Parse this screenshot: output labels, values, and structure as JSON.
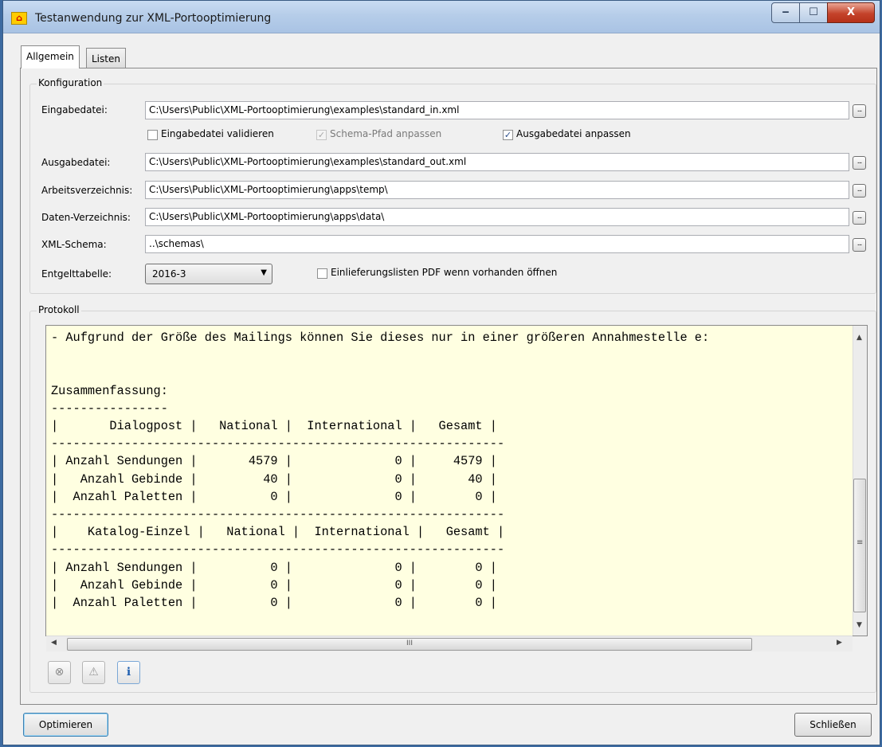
{
  "window": {
    "title": "Testanwendung zur XML-Portooptimierung",
    "icon": "posthorn-icon",
    "controls": {
      "minimize": "‒",
      "maximize": "☐",
      "close": "X"
    }
  },
  "tabs": [
    {
      "label": "Allgemein",
      "active": true
    },
    {
      "label": "Listen",
      "active": false
    }
  ],
  "konfiguration": {
    "group_title": "Konfiguration",
    "eingabedatei": {
      "label": "Eingabedatei:",
      "value": "C:\\Users\\Public\\XML-Portooptimierung\\examples\\standard_in.xml"
    },
    "checkboxes": [
      {
        "label": "Eingabedatei validieren",
        "checked": false,
        "enabled": true
      },
      {
        "label": "Schema-Pfad anpassen",
        "checked": true,
        "enabled": false
      },
      {
        "label": "Ausgabedatei anpassen",
        "checked": true,
        "enabled": true
      }
    ],
    "ausgabedatei": {
      "label": "Ausgabedatei:",
      "value": "C:\\Users\\Public\\XML-Portooptimierung\\examples\\standard_out.xml"
    },
    "arbeitsverzeichnis": {
      "label": "Arbeitsverzeichnis:",
      "value": "C:\\Users\\Public\\XML-Portooptimierung\\apps\\temp\\"
    },
    "datenverzeichnis": {
      "label": "Daten-Verzeichnis:",
      "value": "C:\\Users\\Public\\XML-Portooptimierung\\apps\\data\\"
    },
    "xmlschema": {
      "label": "XML-Schema:",
      "value": "..\\schemas\\"
    },
    "entgelttabelle": {
      "label": "Entgelttabelle:",
      "selected": "2016-3"
    },
    "pdf_checkbox": {
      "label": "Einlieferungslisten PDF wenn vorhanden öffnen",
      "checked": false
    },
    "browse_label": "..."
  },
  "protokoll": {
    "group_title": "Protokoll",
    "lines": [
      "- Aufgrund der Größe des Mailings können Sie dieses nur in einer größeren Annahmestelle e:",
      "",
      "",
      "Zusammenfassung:",
      "----------------",
      "|       Dialogpost |   National |  International |   Gesamt |",
      "--------------------------------------------------------------",
      "| Anzahl Sendungen |       4579 |              0 |     4579 |",
      "|   Anzahl Gebinde |         40 |              0 |       40 |",
      "|  Anzahl Paletten |          0 |              0 |        0 |",
      "--------------------------------------------------------------",
      "|    Katalog-Einzel |   National |  International |   Gesamt |",
      "--------------------------------------------------------------",
      "| Anzahl Sendungen |          0 |              0 |        0 |",
      "|   Anzahl Gebinde |          0 |              0 |        0 |",
      "|  Anzahl Paletten |          0 |              0 |        0 |"
    ],
    "hscroll_grip": "III",
    "vscroll_grip": "≡"
  },
  "log_buttons": [
    {
      "name": "error-filter-icon",
      "glyph": "⊗"
    },
    {
      "name": "warning-filter-icon",
      "glyph": "⚠"
    },
    {
      "name": "info-filter-icon",
      "glyph": "ℹ"
    }
  ],
  "buttons": {
    "optimieren": "Optimieren",
    "schliessen": "Schließen"
  }
}
